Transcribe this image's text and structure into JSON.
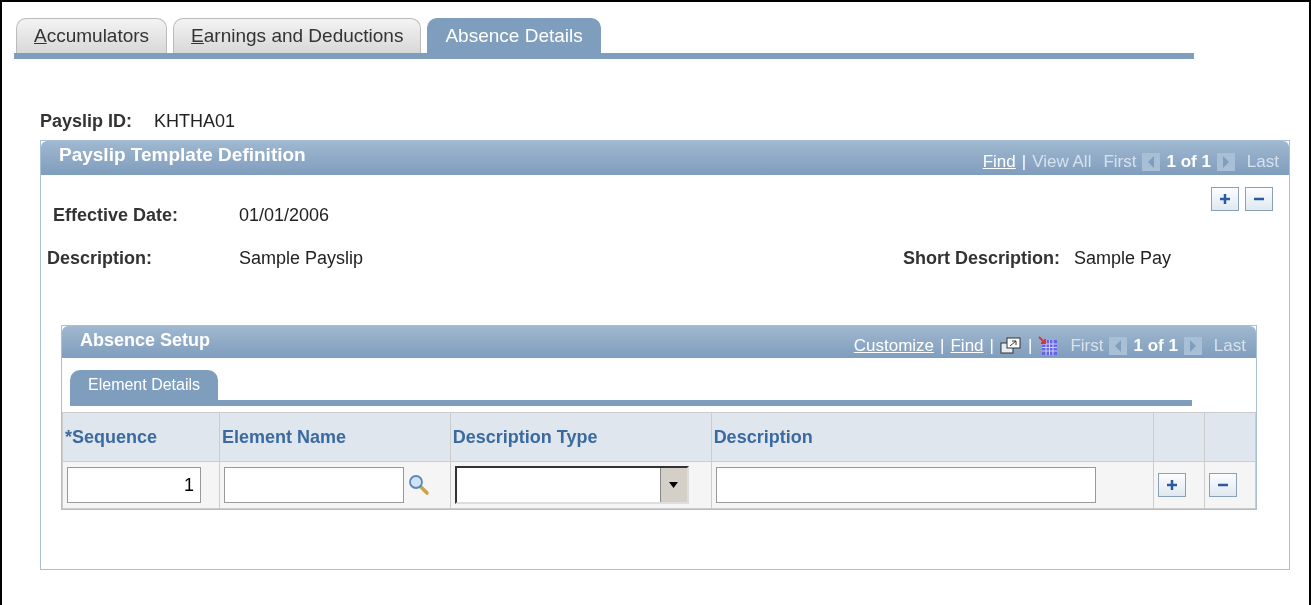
{
  "tabs": [
    {
      "label": "Accumulators",
      "access_key": true,
      "selected": false
    },
    {
      "label": "Earnings and Deductions",
      "access_key": true,
      "selected": false
    },
    {
      "label": "Absence Details",
      "access_key": false,
      "selected": true
    }
  ],
  "payslip_id": {
    "label": "Payslip ID:",
    "value": "KHTHA01"
  },
  "template_definition": {
    "title": "Payslip Template Definition",
    "nav": [
      {
        "kind": "link",
        "label": "Find",
        "disabled": false
      },
      {
        "kind": "separator",
        "label": "|"
      },
      {
        "kind": "link",
        "label": "View All",
        "disabled": true
      },
      {
        "kind": "text",
        "label": "First"
      },
      {
        "kind": "prev",
        "disabled": true
      },
      {
        "kind": "count",
        "label": "1 of 1"
      },
      {
        "kind": "next",
        "disabled": true
      },
      {
        "kind": "text",
        "label": "Last"
      }
    ],
    "effective_date": {
      "label": "Effective Date:",
      "value": "01/01/2006"
    },
    "description": {
      "label": "Description:",
      "value": "Sample Payslip"
    },
    "short_description": {
      "label": "Short Description:",
      "value": "Sample Pay"
    },
    "absence_setup": {
      "title": "Absence Setup",
      "nav": [
        {
          "kind": "link",
          "label": "Customize",
          "disabled": false
        },
        {
          "kind": "separator",
          "label": "|"
        },
        {
          "kind": "link",
          "label": "Find",
          "disabled": false
        },
        {
          "kind": "separator",
          "label": "|"
        },
        {
          "kind": "zoom"
        },
        {
          "kind": "separator",
          "label": "|"
        },
        {
          "kind": "download"
        },
        {
          "kind": "text",
          "label": "First"
        },
        {
          "kind": "prev",
          "disabled": true
        },
        {
          "kind": "count",
          "label": "1 of 1"
        },
        {
          "kind": "next",
          "disabled": true
        },
        {
          "kind": "text",
          "label": "Last"
        }
      ],
      "tabs": [
        {
          "label": "Element Details",
          "selected": true
        }
      ],
      "columns": [
        "*Sequence",
        "Element Name",
        "Description Type",
        "Description"
      ],
      "rows": [
        {
          "sequence": "1"
        }
      ]
    }
  }
}
